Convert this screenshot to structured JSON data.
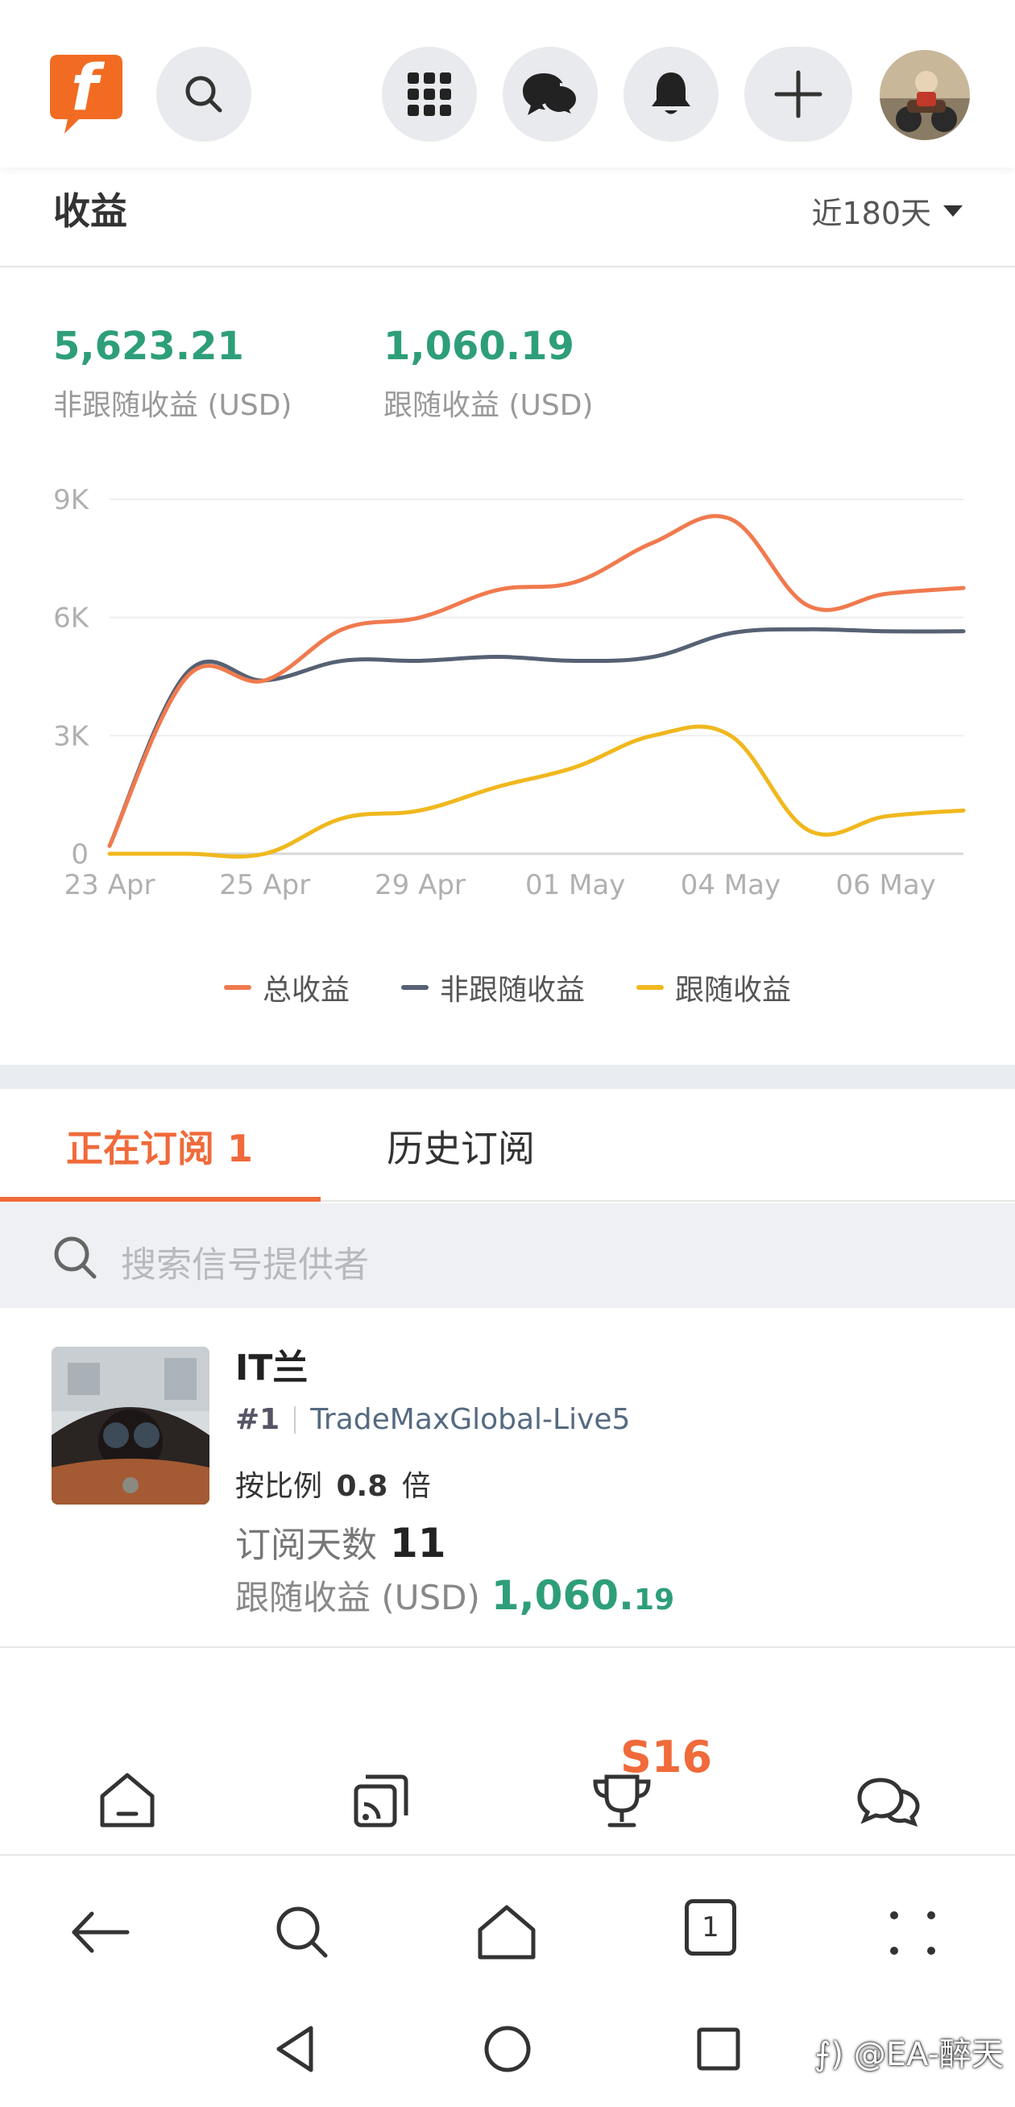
{
  "top_bar": {
    "logo_letter": "f",
    "icons": [
      "search-icon",
      "apps-grid-icon",
      "chat-icon",
      "bell-icon",
      "plus-icon"
    ]
  },
  "earnings": {
    "title": "收益",
    "period": "近180天",
    "non_follow_value": "5,623.21",
    "non_follow_label": "非跟随收益 (USD)",
    "follow_value": "1,060.19",
    "follow_label": "跟随收益 (USD)"
  },
  "chart_data": {
    "type": "line",
    "x": [
      "23 Apr",
      "",
      "25 Apr",
      "",
      "29 Apr",
      "",
      "01 May",
      "",
      "04 May",
      "",
      "06 May",
      ""
    ],
    "x_ticks": [
      "23 Apr",
      "25 Apr",
      "29 Apr",
      "01 May",
      "04 May",
      "06 May"
    ],
    "y_ticks": [
      "0",
      "3K",
      "6K",
      "9K"
    ],
    "ylim": [
      0,
      9000
    ],
    "grid": true,
    "legend_position": "bottom",
    "series": [
      {
        "name": "总收益",
        "color": "#f07a4e",
        "values": [
          200,
          4500,
          4400,
          5700,
          6000,
          6700,
          6900,
          7900,
          8500,
          6300,
          6600,
          6750
        ]
      },
      {
        "name": "非跟随收益",
        "color": "#566174",
        "values": [
          200,
          4600,
          4400,
          4900,
          4900,
          5000,
          4900,
          5000,
          5600,
          5700,
          5650,
          5650
        ]
      },
      {
        "name": "跟随收益",
        "color": "#f0b81e",
        "values": [
          0,
          0,
          0,
          900,
          1100,
          1700,
          2200,
          3000,
          3000,
          600,
          950,
          1100
        ]
      }
    ]
  },
  "tabs": {
    "active": "正在订阅 1",
    "inactive": "历史订阅"
  },
  "search": {
    "placeholder": "搜索信号提供者"
  },
  "subscription": {
    "name": "IT兰",
    "rank": "#1",
    "server": "TradeMaxGlobal-Live5",
    "ratio_label": "按比例",
    "ratio_value": "0.8",
    "ratio_unit": "倍",
    "days_label": "订阅天数",
    "days_value": "11",
    "follow_label": "跟随收益 (USD)",
    "follow_value_main": "1,060.",
    "follow_value_cents": "19"
  },
  "app_nav": {
    "badge": "S16"
  },
  "browser": {
    "tab_count": "1"
  },
  "watermark": "⨍) @EA-醉天"
}
